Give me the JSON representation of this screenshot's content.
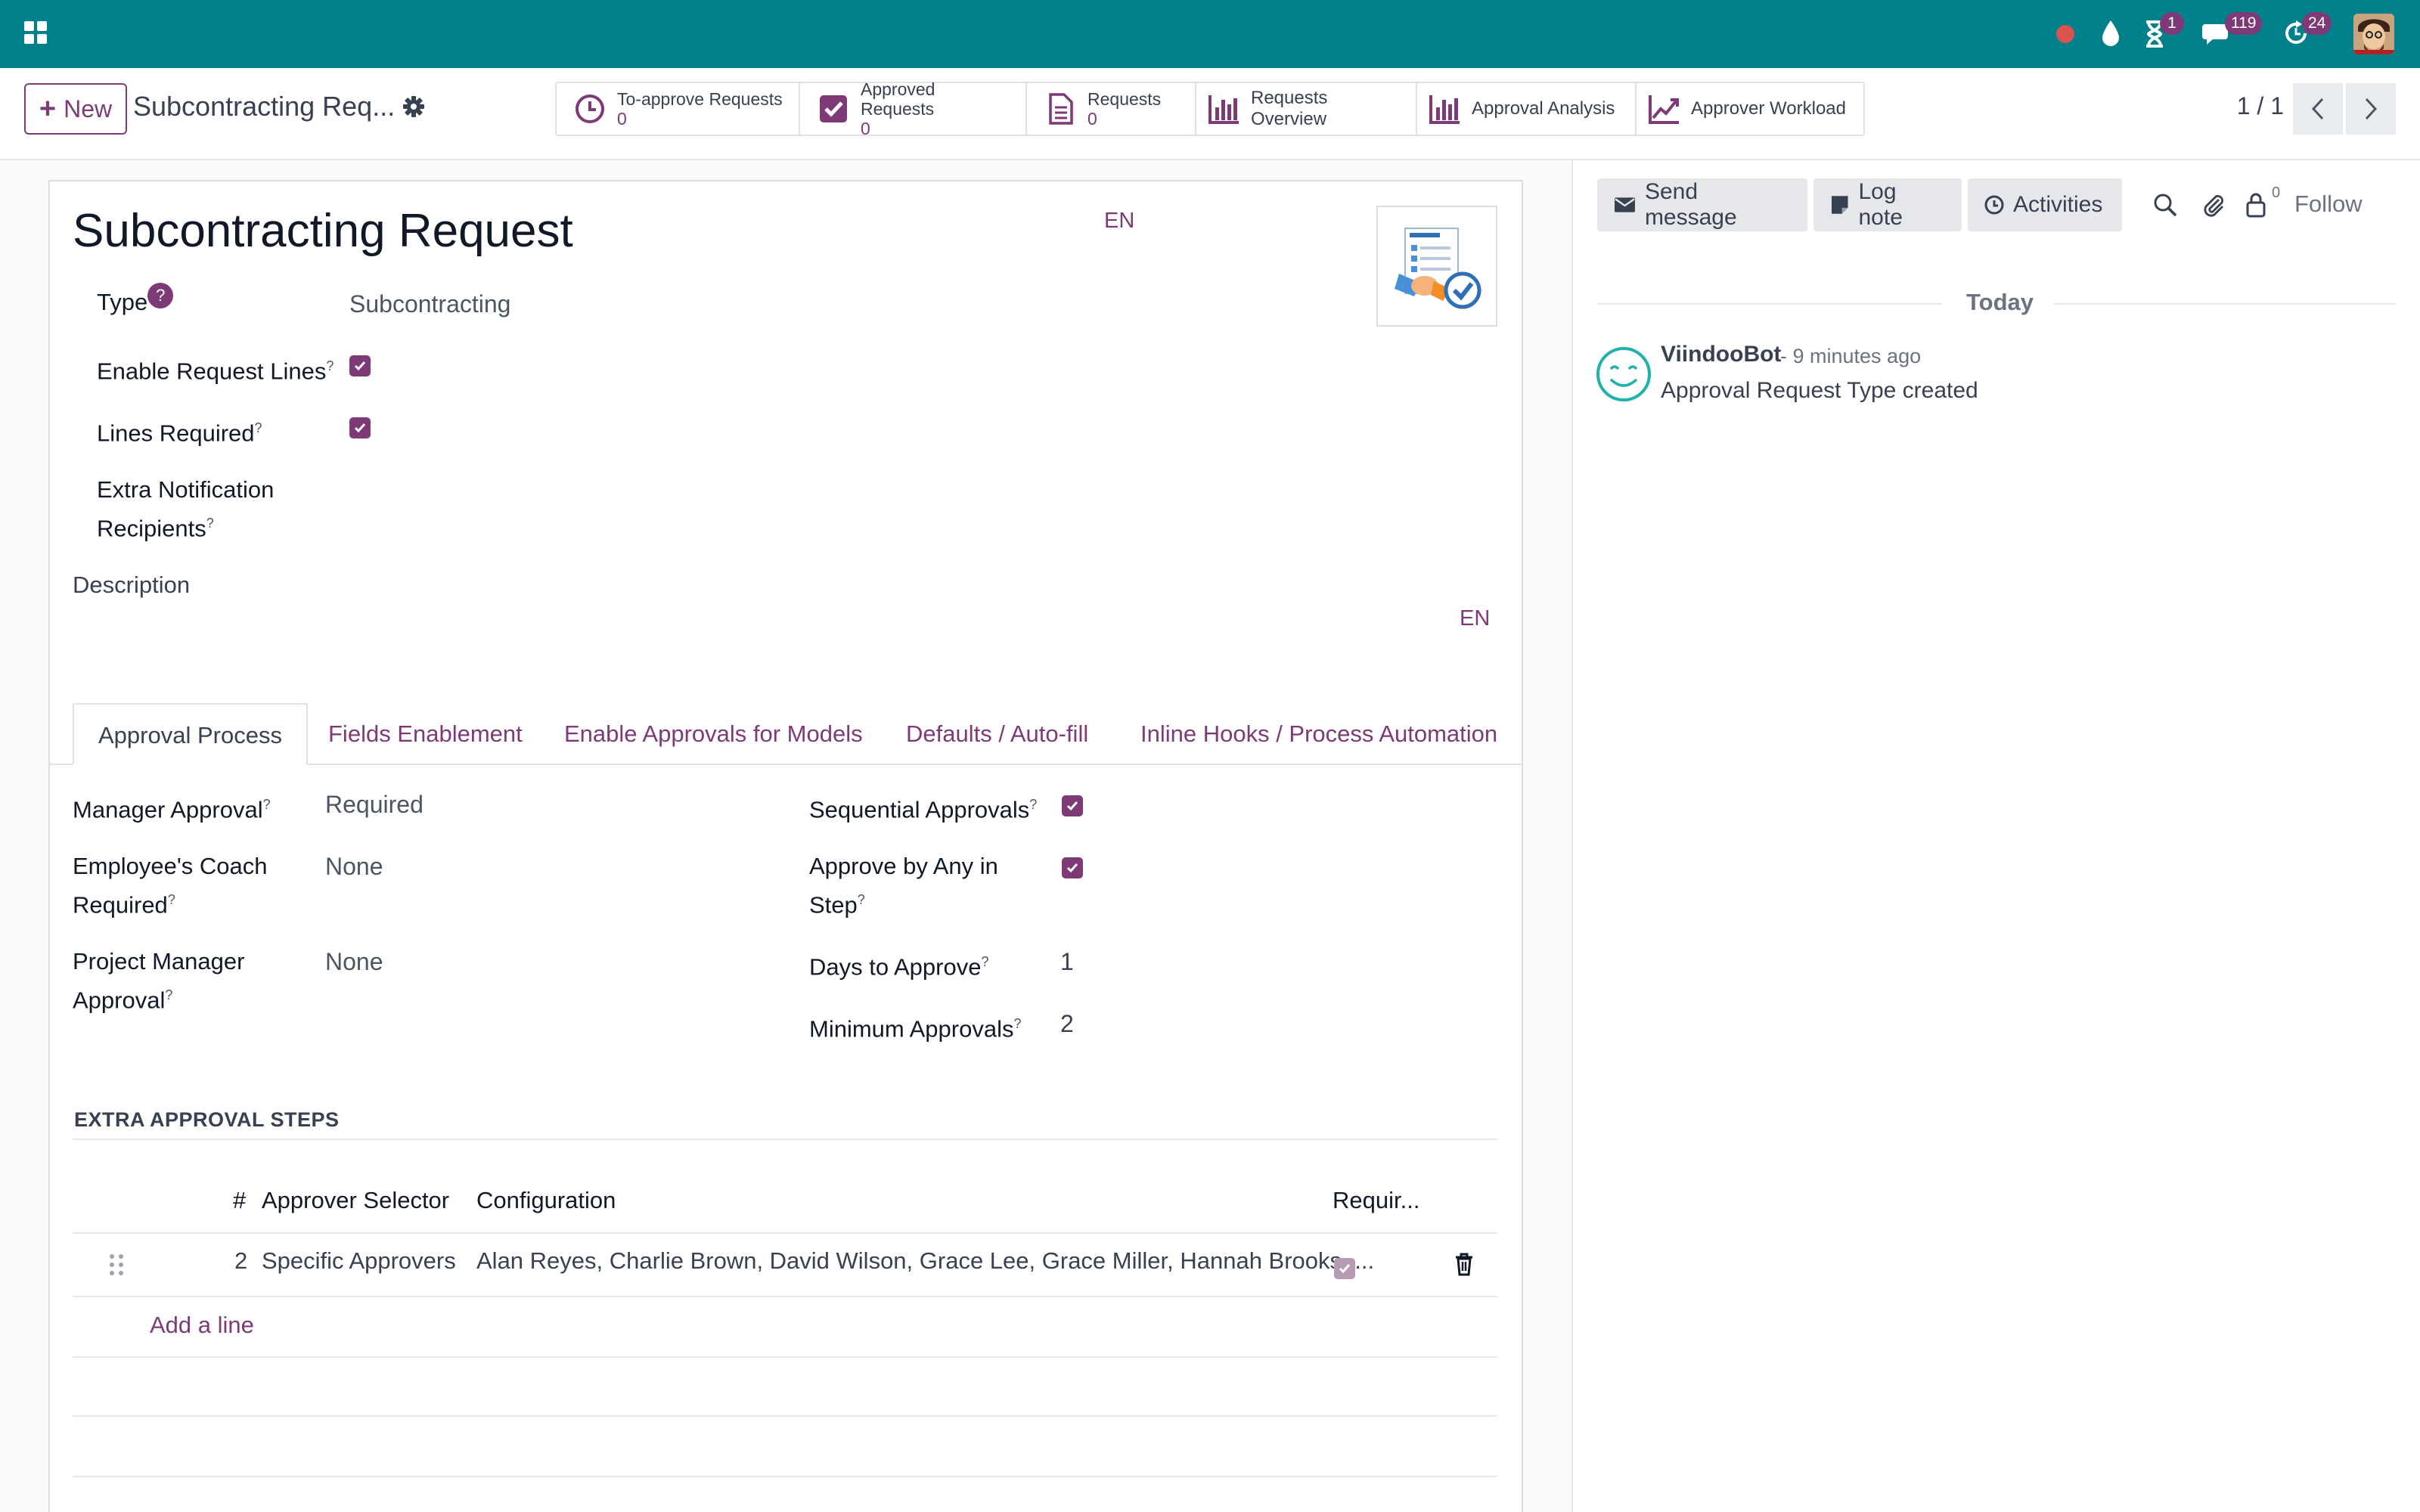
{
  "colors": {
    "navbar": "#00808a",
    "accent": "#7e3a76"
  },
  "navbar": {
    "badges": {
      "activities": "1",
      "messages": "119",
      "updates": "24"
    }
  },
  "control": {
    "new_label": "New",
    "breadcrumb": "Subcontracting Req...",
    "smart_buttons": {
      "to_approve": {
        "label": "To-approve Requests",
        "value": "0"
      },
      "approved": {
        "label": "Approved Requests",
        "value": "0"
      },
      "requests": {
        "label": "Requests",
        "value": "0"
      },
      "overview": "Requests Overview",
      "analysis": "Approval Analysis",
      "workload": "Approver Workload"
    },
    "pager": "1 / 1"
  },
  "form": {
    "title": "Subcontracting Request",
    "lang": "EN",
    "fields": {
      "type_label": "Type",
      "type_value": "Subcontracting",
      "enable_lines_label": "Enable Request Lines",
      "lines_required_label": "Lines Required",
      "extra_notif_label_1": "Extra Notification",
      "extra_notif_label_2": "Recipients",
      "description_label": "Description",
      "description_lang": "EN"
    },
    "tabs": [
      "Approval Process",
      "Fields Enablement",
      "Enable Approvals for Models",
      "Defaults / Auto-fill",
      "Inline Hooks / Process Automation"
    ],
    "approval": {
      "manager_label": "Manager Approval",
      "manager_value": "Required",
      "coach_label_1": "Employee's Coach",
      "coach_label_2": "Required",
      "coach_value": "None",
      "pm_label_1": "Project Manager",
      "pm_label_2": "Approval",
      "pm_value": "None",
      "sequential_label": "Sequential Approvals",
      "any_label_1": "Approve by Any in",
      "any_label_2": "Step",
      "days_label": "Days to Approve",
      "days_value": "1",
      "min_label": "Minimum Approvals",
      "min_value": "2"
    },
    "steps": {
      "section_title": "EXTRA APPROVAL STEPS",
      "columns": {
        "seq": "#",
        "selector": "Approver Selector",
        "config": "Configuration",
        "required": "Requir..."
      },
      "rows": [
        {
          "seq": "2",
          "selector": "Specific Approvers",
          "config": "Alan Reyes, Charlie Brown, David Wilson, Grace Lee, Grace Miller, Hannah Brooks, ..."
        }
      ],
      "add_line": "Add a line"
    }
  },
  "chatter": {
    "send_message": "Send message",
    "log_note": "Log note",
    "activities": "Activities",
    "followers_count": "0",
    "follow": "Follow",
    "today": "Today",
    "message": {
      "author": "ViindooBot",
      "time": "- 9 minutes ago",
      "body": "Approval Request Type created"
    }
  }
}
